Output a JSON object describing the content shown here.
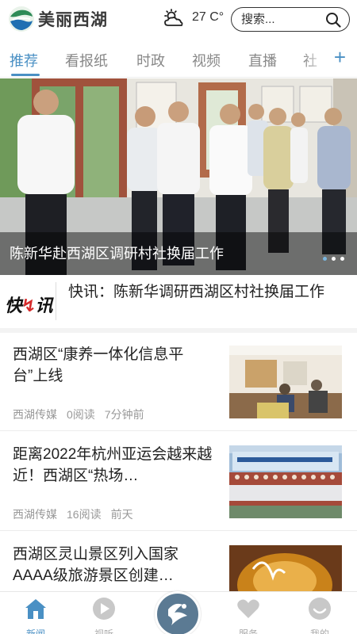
{
  "header": {
    "app_name": "美丽西湖",
    "weather_icon": "sun-cloud-icon",
    "temperature": "27 C°",
    "search_placeholder": "搜索..."
  },
  "tabs": {
    "items": [
      {
        "label": "推荐",
        "active": true
      },
      {
        "label": "看报纸",
        "active": false
      },
      {
        "label": "时政",
        "active": false
      },
      {
        "label": "视频",
        "active": false
      },
      {
        "label": "直播",
        "active": false
      },
      {
        "label": "社",
        "active": false
      }
    ],
    "add_icon": "+"
  },
  "hero": {
    "caption": "陈新华赴西湖区调研村社换届工作",
    "slide_count": 3,
    "active_slide": 1
  },
  "flash": {
    "logo_text": "快讯",
    "text": "快讯：陈新华调研西湖区村社换届工作"
  },
  "news": [
    {
      "title": "西湖区“康养一体化信息平台”上线",
      "source": "西湖传媒",
      "reads": "0阅读",
      "time": "7分钟前"
    },
    {
      "title": "距离2022年杭州亚运会越来越近！西湖区“热场…",
      "source": "西湖传媒",
      "reads": "16阅读",
      "time": "前天"
    },
    {
      "title": "西湖区灵山景区列入国家AAAA级旅游景区创建…",
      "source": "",
      "reads": "",
      "time": ""
    }
  ],
  "bottom_nav": [
    {
      "label": "新闻",
      "icon": "home-icon",
      "active": true
    },
    {
      "label": "视听",
      "icon": "play-icon",
      "active": false
    },
    {
      "label": "",
      "icon": "xihu-logo-icon",
      "active": false
    },
    {
      "label": "服务",
      "icon": "heart-icon",
      "active": false
    },
    {
      "label": "我的",
      "icon": "smile-icon",
      "active": false
    }
  ],
  "colors": {
    "accent": "#4a90c4",
    "flash_bolt": "#d62a2a",
    "meta_text": "#999999"
  }
}
